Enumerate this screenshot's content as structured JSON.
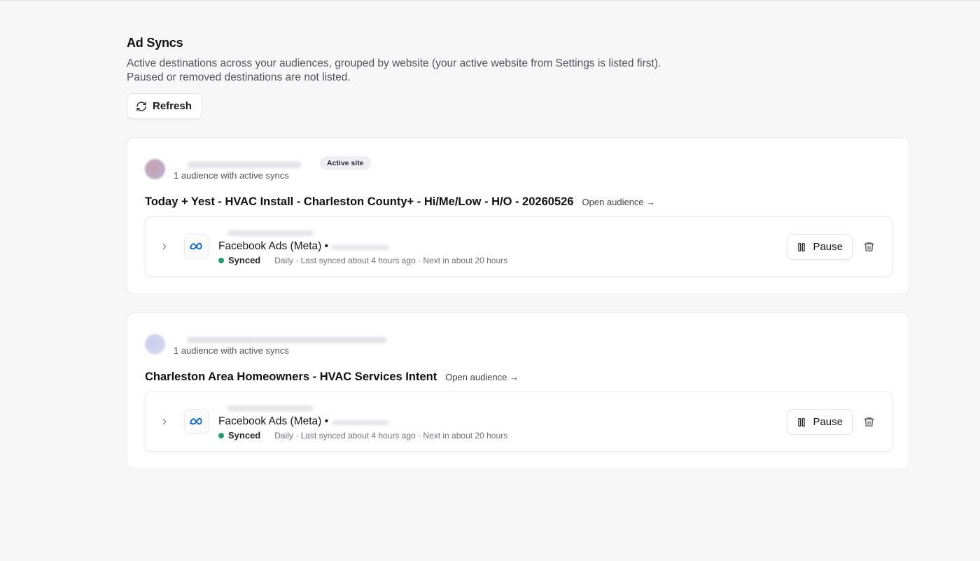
{
  "page": {
    "title": "Ad Syncs",
    "description_line1": "Active destinations across your audiences, grouped by website (your active website from Settings is listed first).",
    "description_line2": "Paused or removed destinations are not listed.",
    "refresh_label": "Refresh"
  },
  "sites": [
    {
      "badge": "Active site",
      "subtitle": "1 audience with active syncs",
      "avatar_colors": [
        "#c9a5b8",
        "#b9b0cf"
      ],
      "audience": {
        "title": "Today + Yest - HVAC Install - Charleston County+ - Hi/Me/Low - H/O - 20260526",
        "open_label": "Open audience →",
        "destination": {
          "name": "Facebook Ads (Meta) •",
          "status": "Synced",
          "status_color": "#22a06b",
          "details": "Daily · Last synced about 4 hours ago · Next in about 20 hours",
          "pause_label": "Pause"
        }
      }
    },
    {
      "badge": "",
      "subtitle": "1 audience with active syncs",
      "avatar_colors": [
        "#c5cbe8",
        "#d6d9ef"
      ],
      "audience": {
        "title": "Charleston Area Homeowners - HVAC Services Intent",
        "open_label": "Open audience →",
        "destination": {
          "name": "Facebook Ads (Meta) •",
          "status": "Synced",
          "status_color": "#22a06b",
          "details": "Daily · Last synced about 4 hours ago · Next in about 20 hours",
          "pause_label": "Pause"
        }
      }
    }
  ],
  "icons": {
    "refresh": "refresh-icon",
    "chevron": "chevron-right-icon",
    "meta": "meta-logo-icon",
    "pause": "pause-icon",
    "trash": "trash-icon"
  },
  "colors": {
    "background": "#f7f7f8",
    "meta_blue": "#0668e1"
  }
}
